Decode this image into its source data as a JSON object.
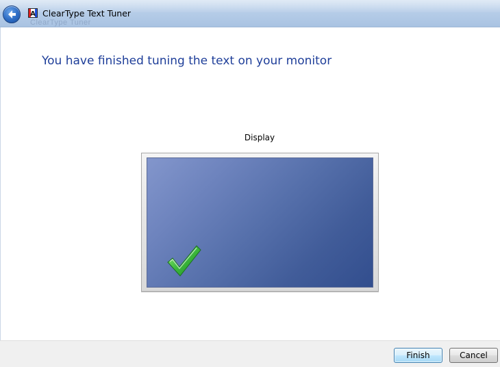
{
  "window": {
    "title": "ClearType Text Tuner",
    "ghost_title": "ClearType Tuner"
  },
  "main": {
    "heading": "You have finished tuning the text on your monitor",
    "display_label": "Display"
  },
  "footer": {
    "finish_label": "Finish",
    "cancel_label": "Cancel"
  },
  "icons": {
    "back": "back-arrow-icon",
    "app": "cleartype-app-icon",
    "check": "checkmark-icon"
  },
  "colors": {
    "heading": "#1e3e99",
    "screen_light": "#8396cc",
    "screen_dark": "#324e8e",
    "check_green": "#3cb83c"
  }
}
